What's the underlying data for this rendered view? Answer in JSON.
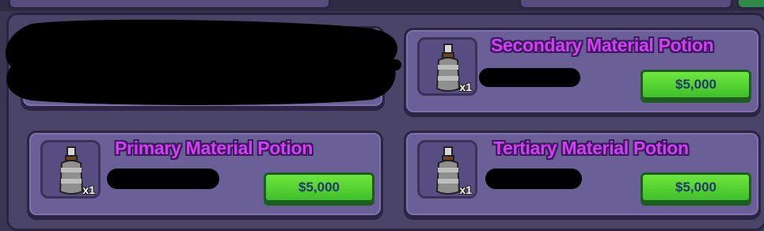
{
  "shop": {
    "items": [
      {
        "title": "",
        "quantity": "",
        "price": ""
      },
      {
        "title": "Secondary Material Potion",
        "quantity": "x1",
        "price": "$5,000"
      },
      {
        "title": "Primary Material Potion",
        "quantity": "x1",
        "price": "$5,000"
      },
      {
        "title": "Tertiary Material Potion",
        "quantity": "x1",
        "price": "$5,000"
      }
    ]
  },
  "icons": {
    "item": "potion-bottle-icon"
  },
  "colors": {
    "title": "#d23ff3",
    "price_button": "#4fd12f",
    "card": "#6a5f96",
    "panel": "#4b4469",
    "redaction": "#000000"
  }
}
